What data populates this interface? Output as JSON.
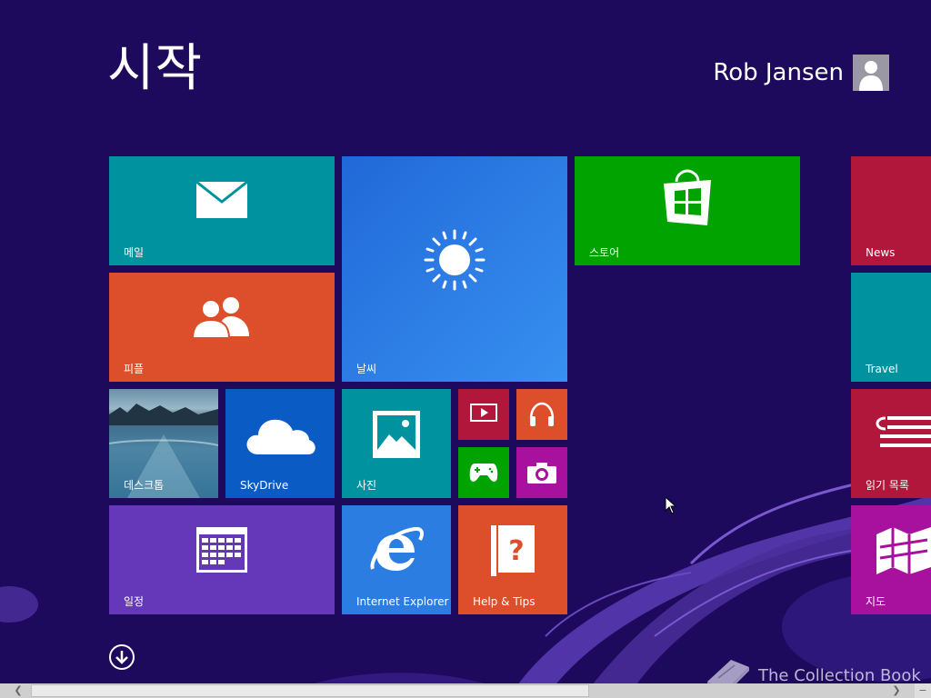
{
  "header": {
    "title": "시작",
    "user_name": "Rob Jansen"
  },
  "tiles": {
    "mail": {
      "label": "메일",
      "color": "#00939f"
    },
    "weather": {
      "label": "날씨",
      "color": "#2b7de1"
    },
    "store": {
      "label": "스토어",
      "color": "#00a300"
    },
    "people": {
      "label": "피플",
      "color": "#dc4f2a"
    },
    "desktop": {
      "label": "데스크톱"
    },
    "skydrive": {
      "label": "SkyDrive",
      "color": "#0a5bc4"
    },
    "photos": {
      "label": "사진",
      "color": "#00939f"
    },
    "video": {
      "color": "#b0173a"
    },
    "music": {
      "color": "#dc4f2a"
    },
    "games": {
      "color": "#00a300"
    },
    "camera": {
      "color": "#a8119e"
    },
    "calendar": {
      "label": "일정",
      "color": "#6438b9"
    },
    "ie": {
      "label": "Internet Explorer",
      "color": "#2b7de1"
    },
    "help": {
      "label": "Help & Tips",
      "color": "#dc4f2a"
    },
    "news": {
      "label": "News",
      "color": "#b0173a"
    },
    "travel": {
      "label": "Travel",
      "color": "#00939f"
    },
    "reading_list": {
      "label": "읽기 목록",
      "color": "#b0173a"
    },
    "maps": {
      "label": "지도",
      "color": "#a8119e"
    }
  },
  "watermark": {
    "text": "The Collection Book"
  },
  "scrollbar": {
    "position_fraction": 0.6
  }
}
